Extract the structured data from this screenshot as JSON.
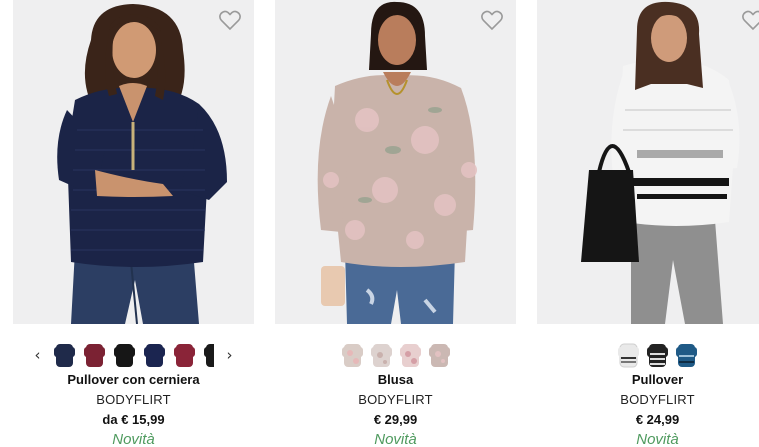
{
  "products": [
    {
      "name": "Pullover con cerniera",
      "brand": "BODYFLIRT",
      "price": "da € 15,99",
      "badge": "Novità",
      "photo": "woman-navy-knit-zip-pullover",
      "swatch_colors": [
        "#1f2a4a",
        "#7b2233",
        "#161616",
        "#1b2550",
        "#8a2438",
        "#1a1a1a"
      ],
      "has_carousel_arrows": true
    },
    {
      "name": "Blusa",
      "brand": "BODYFLIRT",
      "price": "€ 29,99",
      "badge": "Novità",
      "photo": "woman-floral-taupe-blouse",
      "swatch_colors": [
        "#d9ccc6",
        "#ddd2cf",
        "#e8cfcf",
        "#cbb8b3"
      ],
      "has_carousel_arrows": false
    },
    {
      "name": "Pullover",
      "brand": "BODYFLIRT",
      "price": "€ 24,99",
      "badge": "Novità",
      "photo": "woman-white-striped-pullover",
      "swatch_colors": [
        "#e9e9e9",
        "#222222",
        "#1f5a86"
      ],
      "has_carousel_arrows": false
    }
  ],
  "icons": {
    "wishlist": "heart-outline-icon",
    "prev": "chevron-left-icon",
    "next": "chevron-right-icon"
  },
  "colors": {
    "badge_green": "#4e9a5e",
    "photo_bg": "#efeff0"
  }
}
